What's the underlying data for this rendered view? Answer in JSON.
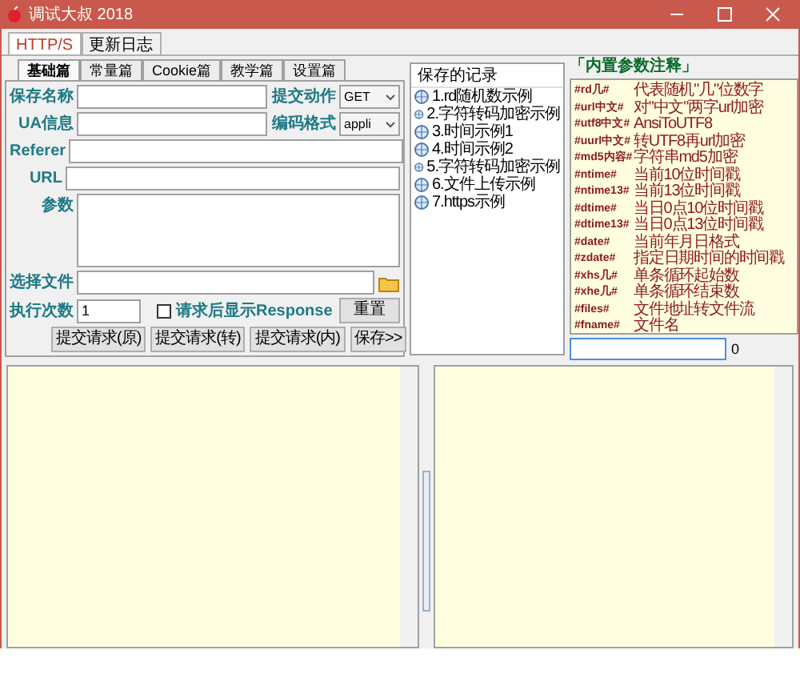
{
  "window": {
    "title": "调试大叔 2018"
  },
  "main_tabs": [
    {
      "label": "HTTP/S",
      "selected": true
    },
    {
      "label": "更新日志",
      "selected": false
    }
  ],
  "sub_tabs": [
    {
      "label": "基础篇",
      "selected": true
    },
    {
      "label": "常量篇",
      "selected": false
    },
    {
      "label": "Cookie篇",
      "selected": false
    },
    {
      "label": "教学篇",
      "selected": false
    },
    {
      "label": "设置篇",
      "selected": false
    }
  ],
  "form": {
    "save_name_label": "保存名称",
    "submit_action_label": "提交动作",
    "submit_action_value": "GET",
    "ua_label": "UA信息",
    "encoding_label": "编码格式",
    "encoding_value": "appli",
    "referer_label": "Referer",
    "url_label": "URL",
    "params_label": "参数",
    "file_label": "选择文件",
    "exec_count_label": "执行次数",
    "exec_count_value": "1",
    "show_response": {
      "label": "请求后显示Response",
      "checked": false
    },
    "reset_button": "重置",
    "buttons": [
      "提交请求(原)",
      "提交请求(转)",
      "提交请求(内)",
      "保存>>"
    ]
  },
  "saved": {
    "title": "保存的记录",
    "items": [
      {
        "label": "1.rd随机数示例"
      },
      {
        "label": "2.字符转码加密示例"
      },
      {
        "label": "3.时间示例1"
      },
      {
        "label": "4.时间示例2"
      },
      {
        "label": "5.字符转码加密示例"
      },
      {
        "label": "6.文件上传示例"
      },
      {
        "label": "7.https示例"
      }
    ]
  },
  "notes": {
    "title": "「内置参数注释」",
    "lines": [
      {
        "key": "#rd几#",
        "text": "代表随机\"几\"位数字"
      },
      {
        "key": "#url中文#",
        "text": "对\"中文\"两字url加密"
      },
      {
        "key": "#utf8中文#",
        "text": "AnsiToUTF8"
      },
      {
        "key": "#uurl中文#",
        "text": "转UTF8再url加密"
      },
      {
        "key": "#md5内容#",
        "text": "字符串md5加密"
      },
      {
        "key": "#ntime#",
        "text": "当前10位时间戳"
      },
      {
        "key": "#ntime13#",
        "text": "当前13位时间戳"
      },
      {
        "key": "#dtime#",
        "text": "当日0点10位时间戳"
      },
      {
        "key": "#dtime13#",
        "text": "当日0点13位时间戳"
      },
      {
        "key": "#date#",
        "text": "当前年月日格式"
      },
      {
        "key": "#zdate#",
        "text": "指定日期时间的时间戳"
      },
      {
        "key": "#xhs几#",
        "text": "单条循环起始数"
      },
      {
        "key": "#xhe几#",
        "text": "单条循环结束数"
      },
      {
        "key": "#files#",
        "text": "文件地址转文件流"
      },
      {
        "key": "#fname#",
        "text": "文件名"
      }
    ],
    "counter": "0"
  }
}
